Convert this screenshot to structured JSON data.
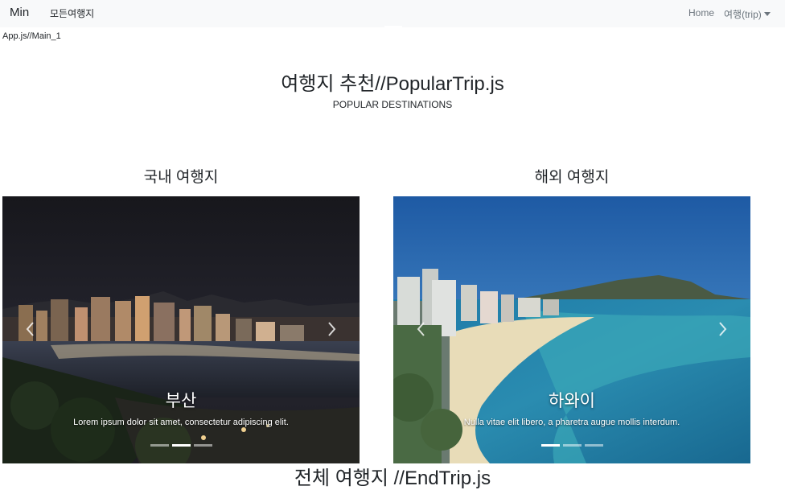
{
  "navbar": {
    "brand": "Min",
    "all_trips": "모든여행지",
    "home": "Home",
    "trip_dropdown": "여행(trip)"
  },
  "route_label": "App.js//Main_1",
  "popular": {
    "title": "여행지 추천//PopularTrip.js",
    "subtitle": "POPULAR DESTINATIONS"
  },
  "domestic": {
    "heading": "국내 여행지",
    "caption_title": "부산",
    "caption_text": "Lorem ipsum dolor sit amet, consectetur adipiscing elit.",
    "active_indicator": 2,
    "indicator_count": 3
  },
  "overseas": {
    "heading": "해외 여행지",
    "caption_title": "하와이",
    "caption_text": "Nulla vitae elit libero, a pharetra augue mollis interdum.",
    "active_indicator": 1,
    "indicator_count": 3
  },
  "end": {
    "title": "전체 여행지 //EndTrip.js"
  },
  "icons": {
    "prev": "chevron-left-icon",
    "next": "chevron-right-icon",
    "dropdown": "caret-down-icon"
  }
}
